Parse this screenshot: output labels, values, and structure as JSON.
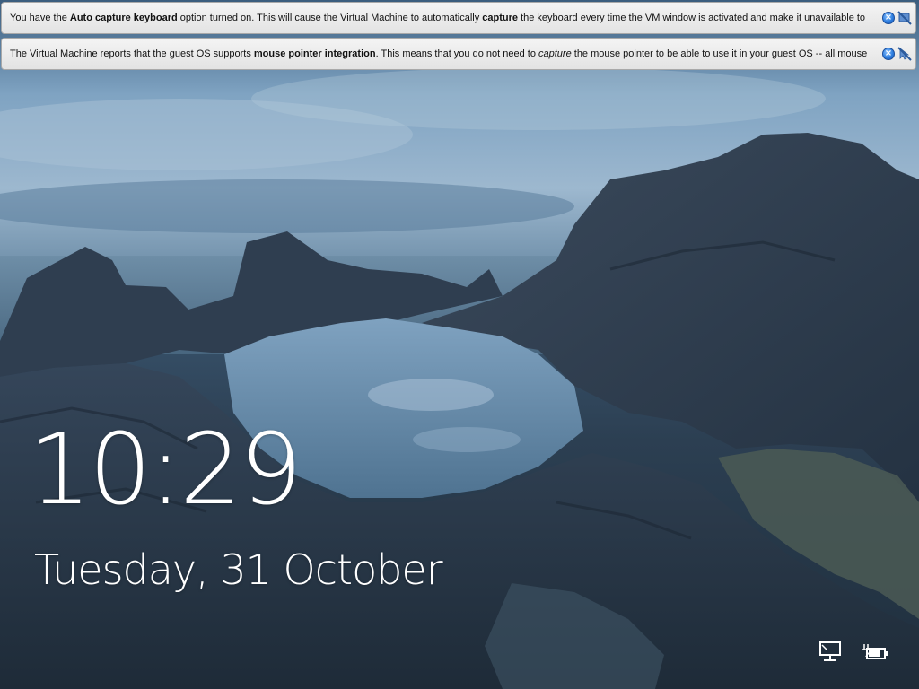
{
  "vm_notifications": [
    {
      "segments": [
        {
          "text": "You have the ",
          "bold": false,
          "italic": false
        },
        {
          "text": "Auto capture keyboard",
          "bold": true,
          "italic": false
        },
        {
          "text": " option turned on. This will cause the Virtual Machine to automatically ",
          "bold": false,
          "italic": false
        },
        {
          "text": "capture",
          "bold": true,
          "italic": false
        },
        {
          "text": " the keyboard every time the VM window is activated and make it unavailable to",
          "bold": false,
          "italic": false
        }
      ],
      "close_label": "×"
    },
    {
      "segments": [
        {
          "text": "The Virtual Machine reports that the guest OS supports ",
          "bold": false,
          "italic": false
        },
        {
          "text": "mouse pointer integration",
          "bold": true,
          "italic": false
        },
        {
          "text": ". This means that you do not need to ",
          "bold": false,
          "italic": false
        },
        {
          "text": "capture",
          "bold": false,
          "italic": true
        },
        {
          "text": " the mouse pointer to be able to use it in your guest OS -- all mouse",
          "bold": false,
          "italic": false
        }
      ],
      "close_label": "×"
    }
  ],
  "lock_screen": {
    "time": "10:29",
    "date": "Tuesday, 31 October"
  },
  "tray": {
    "network_icon": "network-icon",
    "power_icon": "power-icon"
  }
}
